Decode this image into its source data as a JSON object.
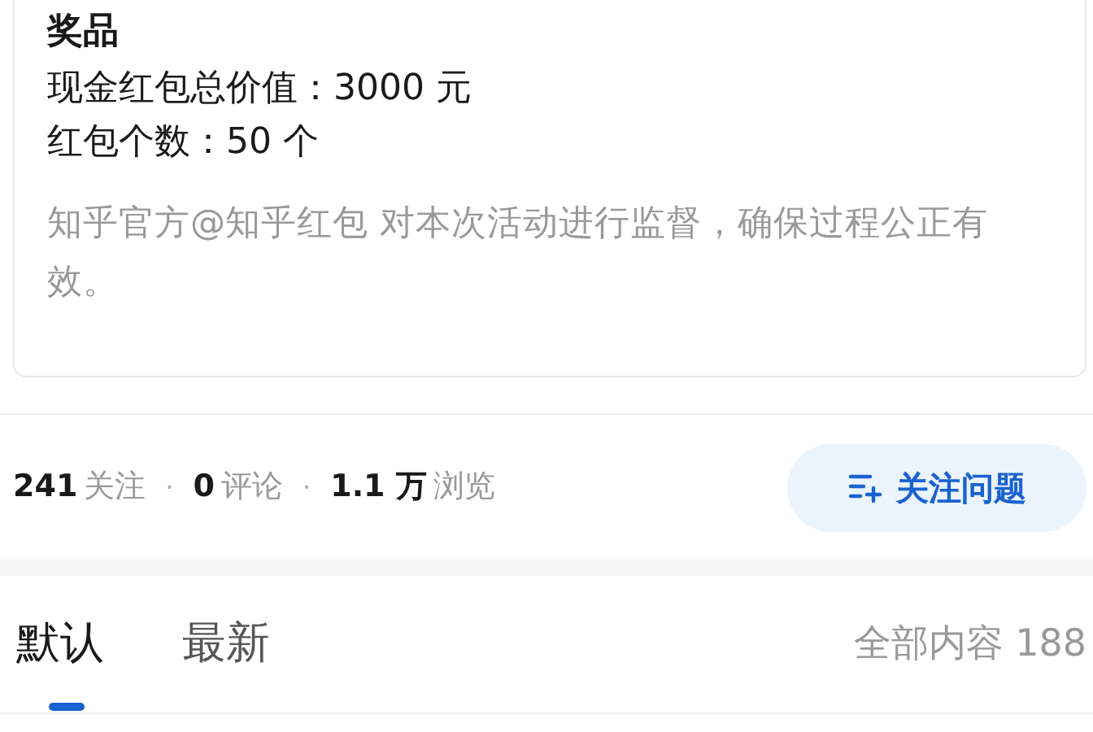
{
  "prize_card": {
    "title": "奖品",
    "lines": [
      "现金红包总价值：3000 元",
      "红包个数：50 个"
    ],
    "note": "知乎官方@知乎红包 对本次活动进行监督，确保过程公正有效。"
  },
  "stats": [
    {
      "number": "241",
      "label": "关注"
    },
    {
      "number": "0",
      "label": "评论"
    },
    {
      "number": "1.1 万",
      "label": "浏览"
    }
  ],
  "separator": "·",
  "follow_button": {
    "label": "关注问题"
  },
  "tabs": [
    {
      "label": "默认",
      "selected": true
    },
    {
      "label": "最新",
      "selected": false
    }
  ],
  "total_label": "全部内容 188"
}
